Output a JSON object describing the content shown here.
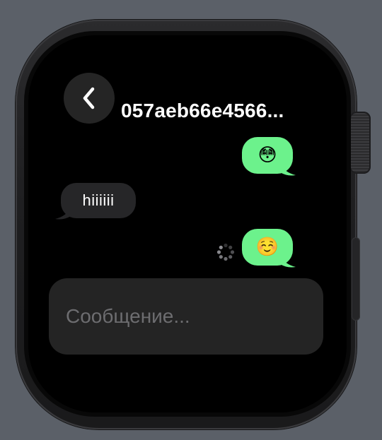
{
  "header": {
    "contact_title": "057aeb66e4566...",
    "back_icon": "chevron-left-icon"
  },
  "messages": [
    {
      "direction": "outgoing",
      "type": "emoji",
      "content": "😳"
    },
    {
      "direction": "incoming",
      "type": "text",
      "content": "hiiiiii"
    },
    {
      "direction": "outgoing",
      "type": "emoji",
      "content": "☺️",
      "status": "sending"
    }
  ],
  "composer": {
    "placeholder": "Сообщение..."
  },
  "colors": {
    "outgoing_bubble": "#6cf28c",
    "incoming_bubble": "#262628",
    "screen_bg": "#000000",
    "composer_bg": "#242424"
  }
}
